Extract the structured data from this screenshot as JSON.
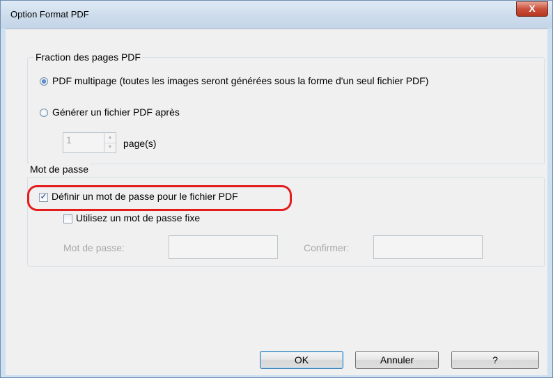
{
  "window": {
    "title": "Option Format PDF",
    "close_glyph": "X"
  },
  "fraction_group": {
    "title": "Fraction des pages PDF",
    "multipage_label": "PDF multipage (toutes les images seront générées sous la forme d'un seul fichier PDF)",
    "multipage_selected": true,
    "generate_after_label": "Générer un fichier PDF après",
    "generate_after_selected": false,
    "pages_value": "1",
    "pages_unit": "page(s)"
  },
  "password_group": {
    "title": "Mot de passe",
    "set_password_label": "Définir un mot de passe pour le fichier PDF",
    "set_password_checked": true,
    "fixed_password_label": "Utilisez un mot de passe fixe",
    "fixed_password_checked": false,
    "password_label": "Mot de passe:",
    "password_value": "",
    "confirm_label": "Confirmer:",
    "confirm_value": ""
  },
  "buttons": {
    "ok": "OK",
    "cancel": "Annuler",
    "help": "?"
  },
  "colors": {
    "highlight": "#e41c1c",
    "dialog_bg": "#f0f0f0",
    "frame": "#cfe0f1"
  }
}
